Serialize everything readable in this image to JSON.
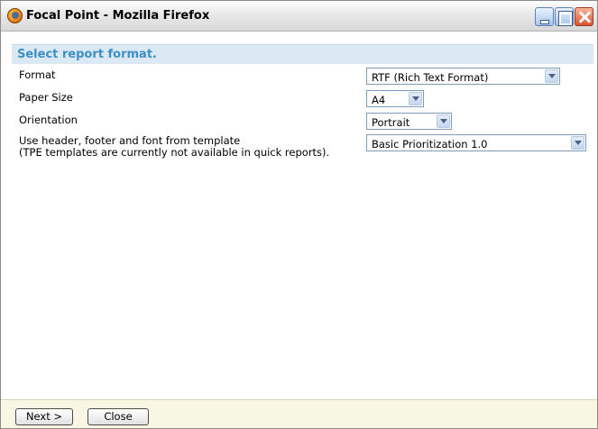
{
  "window": {
    "title": "Focal Point - Mozilla Firefox",
    "app_icon": "firefox-icon",
    "controls": [
      "minimize-icon",
      "maximize-icon",
      "close-icon"
    ]
  },
  "section": {
    "title": "Select report format."
  },
  "form": {
    "format_label": "Format",
    "format_value": "RTF (Rich Text Format)",
    "paper_label": "Paper Size",
    "paper_value": "A4",
    "orientation_label": "Orientation",
    "orientation_value": "Portrait",
    "template_label_line1": "Use header, footer and font from template",
    "template_label_line2": "(TPE templates are currently not available in quick reports).",
    "template_value": "Basic Prioritization 1.0"
  },
  "footer": {
    "next_label": "Next >",
    "close_label": "Close"
  },
  "colors": {
    "section_header_bg": "#dae9f3",
    "section_title": "#3e8fc6",
    "footer_bg": "#f7f7e4"
  }
}
